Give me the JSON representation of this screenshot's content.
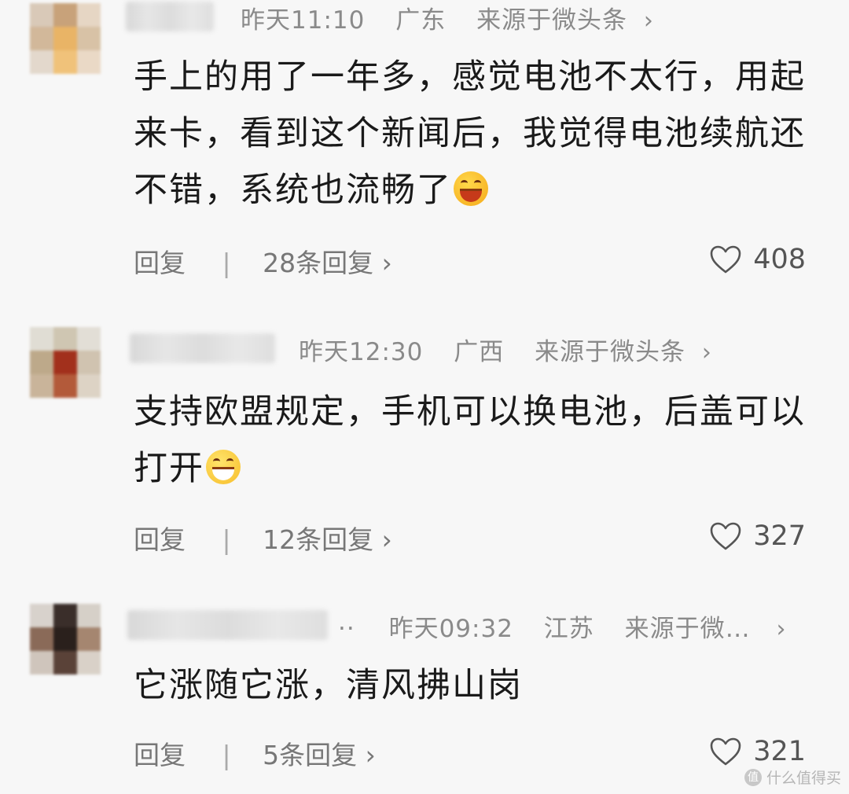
{
  "comments": [
    {
      "time": "昨天11:10",
      "location": "广东",
      "source": "来源于微头条",
      "text": "手上的用了一年多，感觉电池不太行，用起来卡，看到这个新闻后，我觉得电池续航还不错，系统也流畅了",
      "reply_label": "回复",
      "reply_count": "28条回复",
      "likes": "408"
    },
    {
      "time": "昨天12:30",
      "location": "广西",
      "source": "来源于微头条",
      "text": "支持欧盟规定，手机可以换电池，后盖可以打开",
      "reply_label": "回复",
      "reply_count": "12条回复",
      "likes": "327"
    },
    {
      "time": "昨天09:32",
      "location": "江苏",
      "source": "来源于微…",
      "text": "它涨随它涨，清风拂山岗",
      "reply_label": "回复",
      "reply_count": "5条回复",
      "likes": "321"
    }
  ],
  "watermark": {
    "badge": "值",
    "text": "什么值得买"
  },
  "icons": {
    "chevron": "chevron-right-icon",
    "like": "heart-outline-icon",
    "emoji_1": "laughing-face-icon",
    "emoji_2": "grinning-face-icon"
  },
  "colors": {
    "meta": "#8a8a8a",
    "text": "#1a1a1a",
    "background": "#f7f7f7"
  }
}
